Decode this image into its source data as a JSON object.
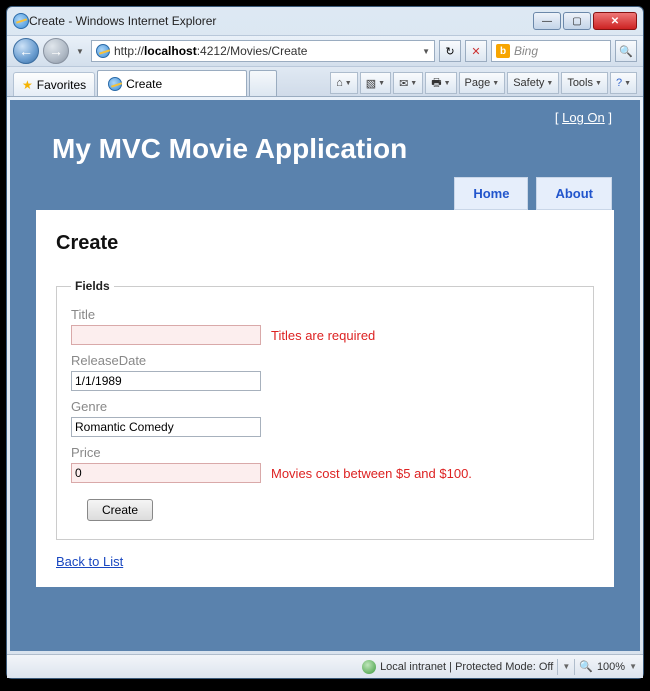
{
  "window": {
    "title": "Create - Windows Internet Explorer"
  },
  "address": {
    "prefix": "http://",
    "host": "localhost",
    "port": ":4212",
    "path": "/Movies/Create"
  },
  "search": {
    "placeholder": "Bing"
  },
  "favorites_label": "Favorites",
  "tab": {
    "title": "Create"
  },
  "toolbar": {
    "page": "Page",
    "safety": "Safety",
    "tools": "Tools"
  },
  "app": {
    "logon_open": "[ ",
    "logon_label": "Log On",
    "logon_close": " ]",
    "title": "My MVC Movie Application",
    "nav_home": "Home",
    "nav_about": "About"
  },
  "form": {
    "heading": "Create",
    "legend": "Fields",
    "title_label": "Title",
    "title_value": "",
    "title_error": "Titles are required",
    "release_label": "ReleaseDate",
    "release_value": "1/1/1989",
    "genre_label": "Genre",
    "genre_value": "Romantic Comedy",
    "price_label": "Price",
    "price_value": "0",
    "price_error": "Movies cost between $5 and $100.",
    "submit": "Create",
    "back": "Back to List"
  },
  "status": {
    "zone": "Local intranet | Protected Mode: Off",
    "zoom": "100%"
  }
}
